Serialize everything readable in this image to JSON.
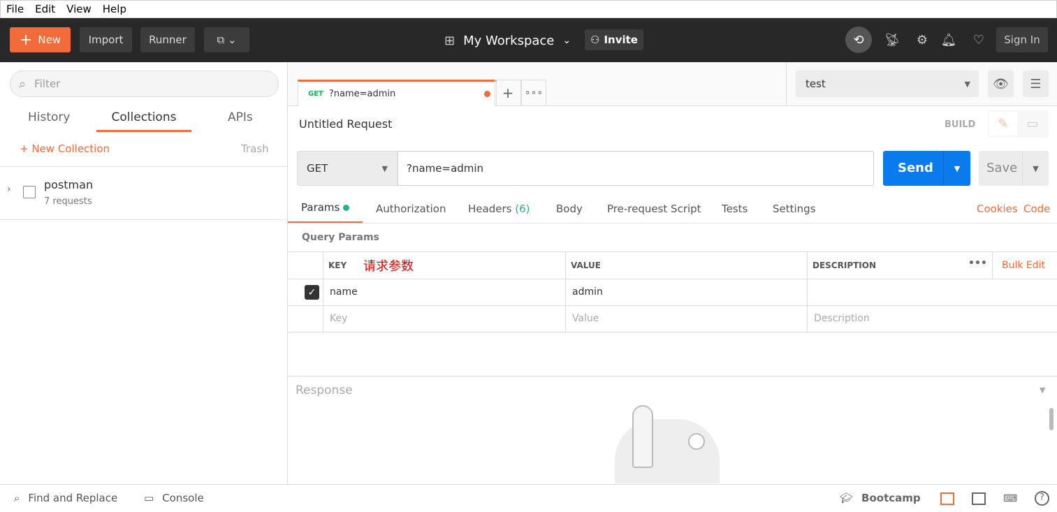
{
  "menu": [
    "File",
    "Edit",
    "View",
    "Help"
  ],
  "topbar": {
    "new": "New",
    "import": "Import",
    "runner": "Runner",
    "workspace": "My Workspace",
    "invite": "Invite",
    "sign_in": "Sign In"
  },
  "sidebar": {
    "filter_placeholder": "Filter",
    "tabs": [
      "History",
      "Collections",
      "APIs"
    ],
    "new_collection": "New Collection",
    "trash": "Trash",
    "collections": [
      {
        "name": "postman",
        "count": "7 requests"
      }
    ]
  },
  "request_tab": {
    "method": "GET",
    "label": "?name=admin"
  },
  "env": {
    "selected": "test"
  },
  "request": {
    "title": "Untitled Request",
    "mode": "BUILD",
    "method": "GET",
    "url": "?name=admin",
    "send": "Send",
    "save": "Save"
  },
  "subtabs": [
    "Params",
    "Authorization",
    "Headers",
    "(6)",
    "Body",
    "Pre-request Script",
    "Tests",
    "Settings"
  ],
  "links": {
    "cookies": "Cookies",
    "code": "Code"
  },
  "params": {
    "title": "Query Params",
    "headers": {
      "key": "KEY",
      "value": "VALUE",
      "description": "DESCRIPTION"
    },
    "annotation": "请求参数",
    "bulk_edit": "Bulk Edit",
    "rows": [
      {
        "checked": true,
        "key": "name",
        "value": "admin",
        "description": ""
      }
    ],
    "placeholders": {
      "key": "Key",
      "value": "Value",
      "description": "Description"
    }
  },
  "response": {
    "title": "Response"
  },
  "footer": {
    "find": "Find and Replace",
    "console": "Console",
    "bootcamp": "Bootcamp"
  },
  "colors": {
    "accent": "#f26b3a",
    "send": "#097bed",
    "topbar": "#282828"
  }
}
